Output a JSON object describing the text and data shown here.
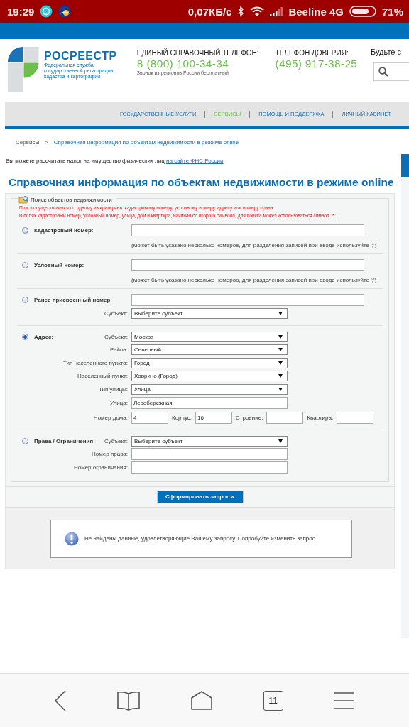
{
  "status_bar": {
    "time": "19:29",
    "speed": "0,07КБ/с",
    "carrier": "Beeline 4G",
    "battery": "71%"
  },
  "header": {
    "logo_title": "РОСРЕЕСТР",
    "logo_subtitle": [
      "Федеральная служба",
      "государственной регистрации,",
      "кадастра и картографии"
    ],
    "hotline_label": "ЕДИНЫЙ СПРАВОЧНЫЙ ТЕЛЕФОН:",
    "hotline_number": "8 (800) 100-34-34",
    "hotline_note": "Звонок из регионов России бесплатный",
    "trust_label": "ТЕЛЕФОН ДОВЕРИЯ:",
    "trust_number": "(495) 917-38-25",
    "cut_text": "Будьте с"
  },
  "nav": [
    {
      "label": "ГОСУДАРСТВЕННЫЕ УСЛУГИ",
      "selected": false
    },
    {
      "label": "СЕРВИСЫ",
      "selected": true
    },
    {
      "label": "ПОМОЩЬ И ПОДДЕРЖКА",
      "selected": false
    },
    {
      "label": "ЛИЧНЫЙ КАБИНЕТ",
      "selected": false
    }
  ],
  "breadcrumb": {
    "separator": ">",
    "items": [
      {
        "label": "Сервисы",
        "kind": "text"
      },
      {
        "label": "Справочная информация по объектам недвижимости в режиме online",
        "kind": "link"
      }
    ]
  },
  "tax_note": {
    "text": "Вы можете рассчитать налог на имущество физических лиц",
    "link": "на сайте ФНС России",
    "end": "."
  },
  "page_title": "Справочная информация по объектам недвижимости в режиме online",
  "search_form": {
    "legend": "Поиск объектов недвижимости",
    "notes": [
      "Поиск осуществляется по одному из критериев: кадастровому номеру, условному номеру, адресу или номеру права.",
      "В полях кадастровый номер, условный номер, улица, дом и квартира, начиная со второго символа, для поиска может использоваться символ \"*\"."
    ],
    "criteria": [
      {
        "label": "Кадастровый номер:",
        "selected": false,
        "rows": [
          {
            "kind": "input"
          },
          {
            "kind": "hint",
            "text": "(может быть указано несколько номеров, для разделения записей при вводе используйте ';')"
          }
        ]
      },
      {
        "label": "Условный номер:",
        "selected": false,
        "rows": [
          {
            "kind": "input"
          },
          {
            "kind": "hint",
            "text": "(может быть указано несколько номеров, для разделения записей при вводе используйте ';')"
          }
        ]
      },
      {
        "label": "Ранее присвоенный номер:",
        "selected": false,
        "rows": [
          {
            "kind": "input"
          },
          {
            "kind": "select",
            "label": "Субъект:",
            "value": "Выберите субъект"
          }
        ]
      },
      {
        "label": "Адрес:",
        "selected": true,
        "rows": [
          {
            "kind": "select",
            "label": "Субъект:",
            "value": "Москва"
          },
          {
            "kind": "select",
            "label": "Район:",
            "value": "Северный"
          },
          {
            "kind": "select",
            "label": "Тип населенного пункта:",
            "value": "Город"
          },
          {
            "kind": "select",
            "label": "Населенный пункт:",
            "value": "Ховрино (Город)"
          },
          {
            "kind": "select",
            "label": "Тип улицы:",
            "value": "Улица"
          },
          {
            "kind": "short_input",
            "label": "Улица:",
            "value": "Левобережная"
          },
          {
            "kind": "inline",
            "fields": [
              {
                "label": "Номер дома:",
                "value": "4"
              },
              {
                "label": "Корпус:",
                "value": "16"
              },
              {
                "label": "Строение:"
              },
              {
                "label": "Квартира:"
              }
            ]
          }
        ]
      },
      {
        "label": "Права / Ограничения:",
        "selected": false,
        "rows": [
          {
            "kind": "select",
            "label": "Субъект:",
            "value": "Выберите субъект"
          },
          {
            "kind": "short_input",
            "label": "Номер права:"
          },
          {
            "kind": "short_input",
            "label": "Номер ограничения:"
          }
        ]
      }
    ]
  },
  "submit": "Сформировать запрос »",
  "message": "Не найдены данные, удовлетворяющие Вашему запросу. Попробуйте изменить запрос.",
  "browser_bar": {
    "tab_count": "11"
  }
}
